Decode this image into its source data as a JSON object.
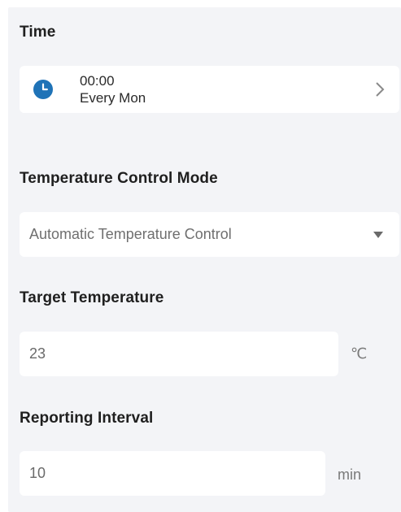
{
  "time": {
    "title": "Time",
    "schedule_time": "00:00",
    "schedule_repeat": "Every Mon",
    "icon": "clock-icon",
    "chevron_icon": "chevron-right-icon"
  },
  "temperature_control_mode": {
    "title": "Temperature Control Mode",
    "selected": "Automatic Temperature Control",
    "dropdown_icon": "caret-down-icon"
  },
  "target_temperature": {
    "title": "Target Temperature",
    "value": "23",
    "unit": "℃"
  },
  "reporting_interval": {
    "title": "Reporting Interval",
    "value": "10",
    "unit": "min"
  },
  "colors": {
    "background": "#f3f4f7",
    "card": "#ffffff",
    "accent": "#1f73b7",
    "text": "#1f1f1f",
    "muted": "#6f6f6f"
  }
}
